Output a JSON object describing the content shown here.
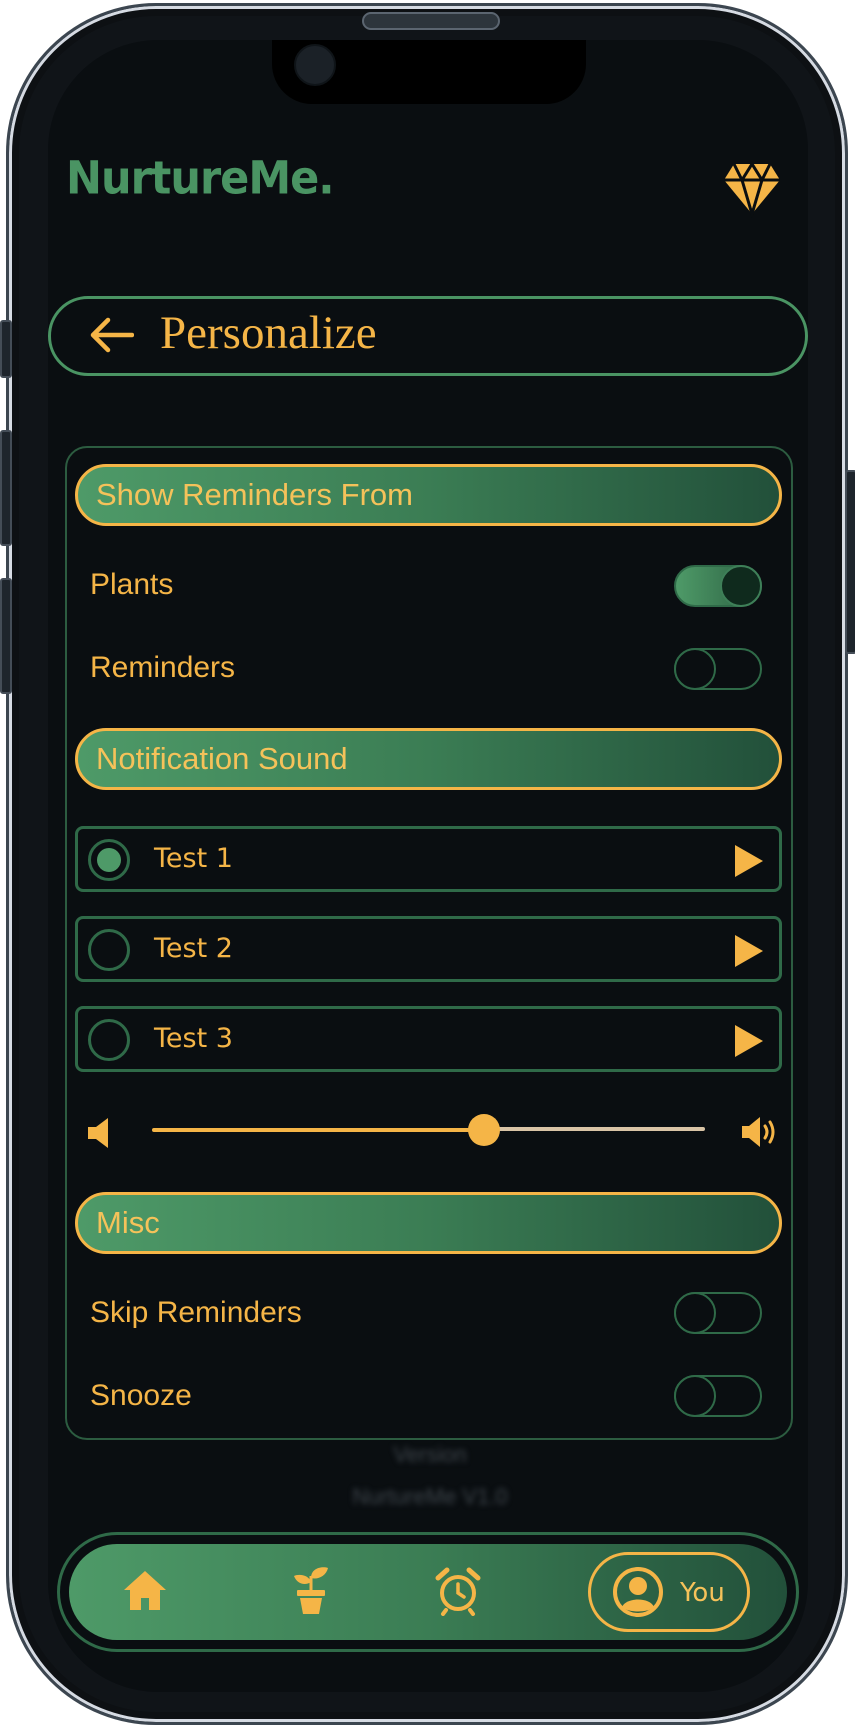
{
  "app": {
    "logo": "NurtureMe."
  },
  "header": {
    "title": "Personalize"
  },
  "sections": {
    "reminders_header": "Show Reminders From",
    "sound_header": "Notification Sound",
    "misc_header": "Misc"
  },
  "reminders_from": [
    {
      "label": "Plants",
      "on": true
    },
    {
      "label": "Reminders",
      "on": false
    }
  ],
  "sounds": [
    {
      "label": "Test 1",
      "selected": true
    },
    {
      "label": "Test 2",
      "selected": false
    },
    {
      "label": "Test 3",
      "selected": false
    }
  ],
  "volume": {
    "level": 0.6
  },
  "misc": [
    {
      "label": "Skip Reminders",
      "on": false
    },
    {
      "label": "Snooze",
      "on": false
    }
  ],
  "footer": {
    "version_label": "Version",
    "version_value": "NurtureMe V1.0"
  },
  "nav": {
    "items": [
      "home-icon",
      "plant-icon",
      "alarm-icon",
      "profile-icon"
    ],
    "active_label": "You"
  },
  "colors": {
    "accent": "#f5b547",
    "brand_green": "#4a9463",
    "dark_green": "#22503a",
    "background": "#0a0e11"
  }
}
